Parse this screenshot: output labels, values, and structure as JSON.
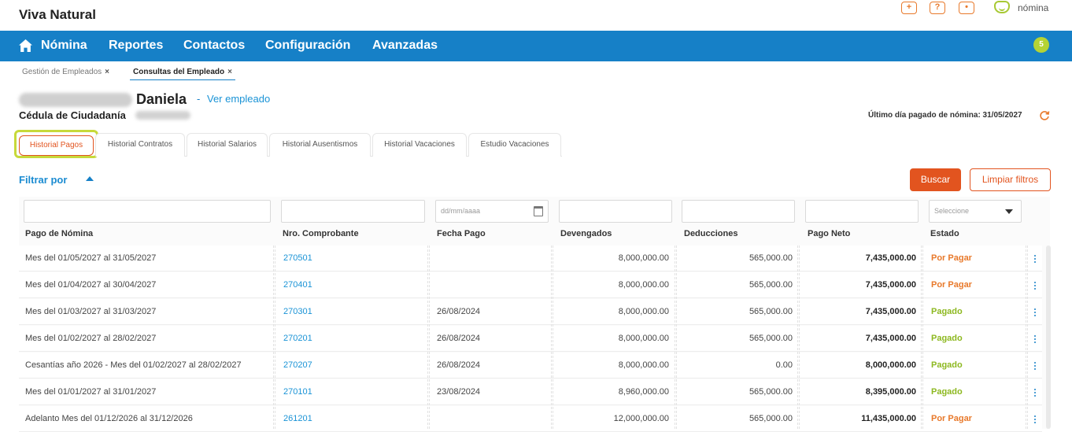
{
  "app": {
    "brand": "Viva Natural",
    "logo_text": "nómina",
    "icons": [
      "plus-icon",
      "help-icon",
      "user-icon"
    ],
    "accent": "#1680c7",
    "orange": "#e2541f",
    "green": "#8db820"
  },
  "nav": {
    "items": [
      "Nómina",
      "Reportes",
      "Contactos",
      "Configuración",
      "Avanzadas"
    ],
    "badge": "5"
  },
  "breadcrumbs": [
    {
      "label": "Gestión de Empleados",
      "close": "×"
    },
    {
      "label": "Consultas del Empleado",
      "close": "×",
      "active": true
    }
  ],
  "employee": {
    "name": "Daniela",
    "separator": "-",
    "view_link": "Ver empleado",
    "id_label": "Cédula de Ciudadanía",
    "last_paid": "Último día pagado de nómina: 31/05/2027"
  },
  "tabs": [
    "Historial Pagos",
    "Historial Contratos",
    "Historial Salarios",
    "Historial Ausentismos",
    "Historial Vacaciones",
    "Estudio Vacaciones"
  ],
  "filters": {
    "label": "Filtrar por",
    "search_button": "Buscar",
    "clear_button": "Limpiar filtros",
    "date_placeholder": "dd/mm/aaaa",
    "state_placeholder": "Seleccione"
  },
  "table": {
    "columns": [
      "Pago de Nómina",
      "Nro. Comprobante",
      "Fecha Pago",
      "Devengados",
      "Deducciones",
      "Pago Neto",
      "Estado"
    ],
    "rows": [
      {
        "pago": "Mes del 01/05/2027 al 31/05/2027",
        "comprobante": "270501",
        "fecha": "",
        "devengados": "8,000,000.00",
        "deducciones": "565,000.00",
        "neto": "7,435,000.00",
        "estado": "Por Pagar"
      },
      {
        "pago": "Mes del 01/04/2027 al 30/04/2027",
        "comprobante": "270401",
        "fecha": "",
        "devengados": "8,000,000.00",
        "deducciones": "565,000.00",
        "neto": "7,435,000.00",
        "estado": "Por Pagar"
      },
      {
        "pago": "Mes del 01/03/2027 al 31/03/2027",
        "comprobante": "270301",
        "fecha": "26/08/2024",
        "devengados": "8,000,000.00",
        "deducciones": "565,000.00",
        "neto": "7,435,000.00",
        "estado": "Pagado"
      },
      {
        "pago": "Mes del 01/02/2027 al 28/02/2027",
        "comprobante": "270201",
        "fecha": "26/08/2024",
        "devengados": "8,000,000.00",
        "deducciones": "565,000.00",
        "neto": "7,435,000.00",
        "estado": "Pagado"
      },
      {
        "pago": "Cesantías año 2026 - Mes del 01/02/2027 al 28/02/2027",
        "comprobante": "270207",
        "fecha": "26/08/2024",
        "devengados": "8,000,000.00",
        "deducciones": "0.00",
        "neto": "8,000,000.00",
        "estado": "Pagado"
      },
      {
        "pago": "Mes del 01/01/2027 al 31/01/2027",
        "comprobante": "270101",
        "fecha": "23/08/2024",
        "devengados": "8,960,000.00",
        "deducciones": "565,000.00",
        "neto": "8,395,000.00",
        "estado": "Pagado"
      },
      {
        "pago": "Adelanto Mes del 01/12/2026 al 31/12/2026",
        "comprobante": "261201",
        "fecha": "",
        "devengados": "12,000,000.00",
        "deducciones": "565,000.00",
        "neto": "11,435,000.00",
        "estado": "Por Pagar"
      }
    ]
  }
}
